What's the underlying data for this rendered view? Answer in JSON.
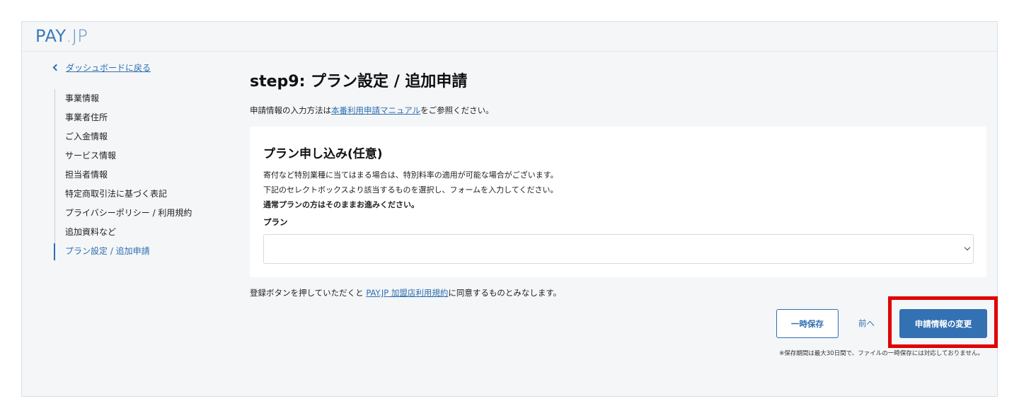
{
  "header": {
    "logo_main": "PAY",
    "logo_dot": ".JP"
  },
  "sidebar": {
    "back_label": "ダッシュボードに戻る",
    "items": [
      {
        "label": "事業情報"
      },
      {
        "label": "事業者住所"
      },
      {
        "label": "ご入金情報"
      },
      {
        "label": "サービス情報"
      },
      {
        "label": "担当者情報"
      },
      {
        "label": "特定商取引法に基づく表記"
      },
      {
        "label": "プライバシーポリシー / 利用規約"
      },
      {
        "label": "追加資料など"
      },
      {
        "label": "プラン設定 / 追加申請",
        "active": true
      }
    ]
  },
  "main": {
    "title": "step9: プラン設定 / 追加申請",
    "intro_prefix": "申請情報の入力方法は",
    "intro_link": "本番利用申請マニュアル",
    "intro_suffix": "をご参照ください。",
    "card": {
      "heading": "プラン申し込み(任意)",
      "line1": "寄付など特別業種に当てはまる場合は、特別料率の適用が可能な場合がございます。",
      "line2": "下記のセレクトボックスより該当するものを選択し、フォームを入力してください。",
      "line3": "通常プランの方はそのままお進みください。",
      "field_label": "プラン",
      "select_value": ""
    },
    "terms_prefix": "登録ボタンを押していただくと ",
    "terms_link": "PAY.JP 加盟店利用規約",
    "terms_suffix": "に同意するものとみなします。",
    "buttons": {
      "save": "一時保存",
      "prev": "前へ",
      "submit": "申請情報の変更"
    },
    "note": "※保存期間は最大30日間で、ファイルの一時保存には対応しておりません。"
  },
  "colors": {
    "accent": "#3371b3",
    "highlight": "#e00000",
    "background": "#f5f6f8"
  }
}
